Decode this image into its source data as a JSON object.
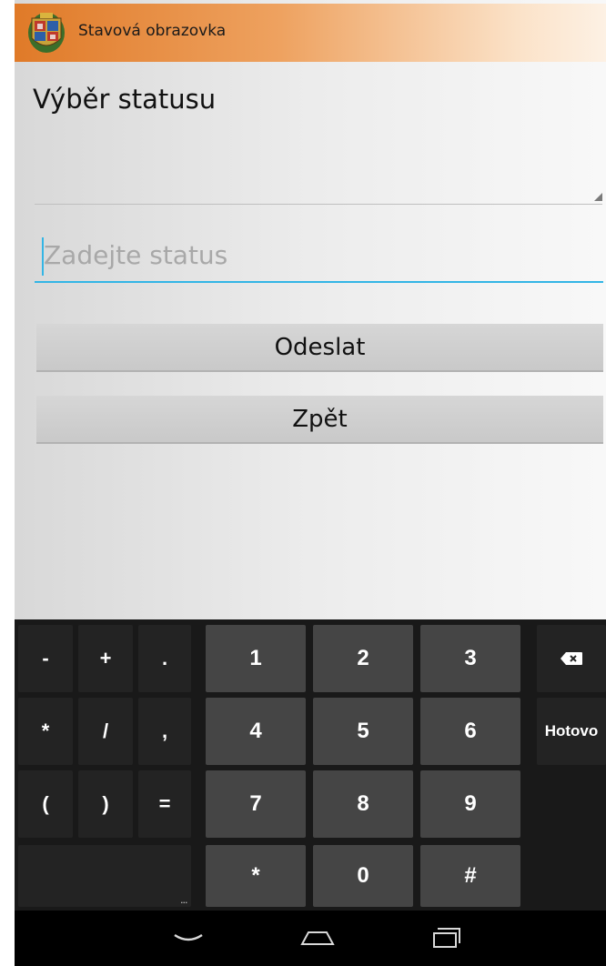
{
  "app": {
    "title": "Stavová obrazovka",
    "icon": "coat-of-arms-icon",
    "accent_color": "#e07a28"
  },
  "form": {
    "status_label": "Výběr statusu",
    "status_select_value": "",
    "status_input_value": "",
    "status_input_placeholder": "Zadejte status",
    "input_focus_color": "#33b5e5",
    "send_label": "Odeslat",
    "back_label": "Zpět"
  },
  "keyboard": {
    "symbol_rows": [
      [
        "-",
        "+",
        "."
      ],
      [
        "*",
        "/",
        ","
      ],
      [
        "(",
        ")",
        "="
      ]
    ],
    "number_rows": [
      [
        "1",
        "2",
        "3"
      ],
      [
        "4",
        "5",
        "6"
      ],
      [
        "7",
        "8",
        "9"
      ],
      [
        "*",
        "0",
        "#"
      ]
    ],
    "backspace_icon": "backspace-icon",
    "done_label": "Hotovo",
    "space_hint": "..."
  },
  "navbar": {
    "icons": [
      "hide-keyboard-icon",
      "home-icon",
      "recent-apps-icon"
    ]
  }
}
